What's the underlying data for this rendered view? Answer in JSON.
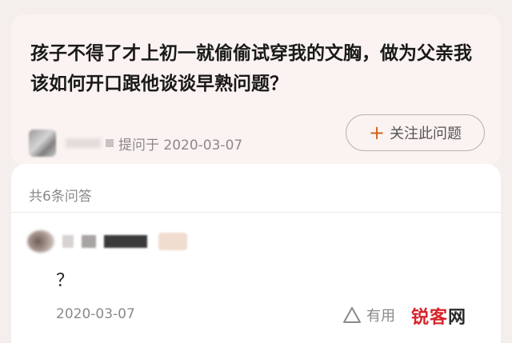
{
  "question": {
    "title": "孩子不得了才上初一就偷偷试穿我的文胸，做为父亲我该如何开口跟他谈谈早熟问题？",
    "asked_label": "提问于 2020-03-07",
    "follow_button": "关注此问题"
  },
  "answers": {
    "count_label": "共6条问答",
    "items": [
      {
        "text": "？",
        "date": "2020-03-07",
        "useful_label": "有用"
      }
    ]
  },
  "watermark": {
    "text_main": "锐客",
    "text_last": "网"
  },
  "icons": {
    "follow": "plus-icon",
    "useful": "triangle-up-icon"
  },
  "colors": {
    "accent": "#d2621e",
    "watermark_red": "#d8232a"
  }
}
